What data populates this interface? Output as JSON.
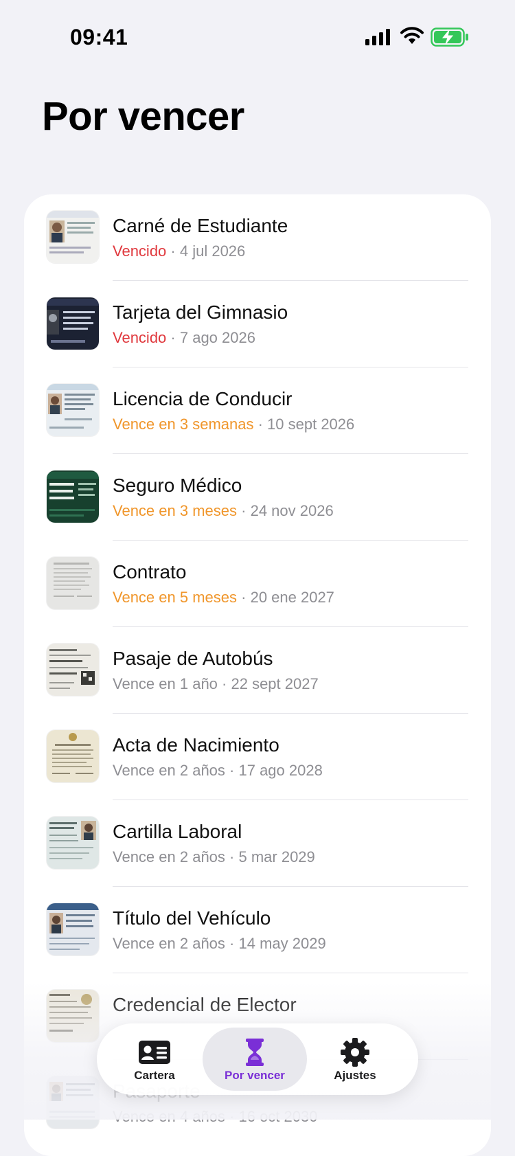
{
  "status_bar": {
    "time": "09:41"
  },
  "page": {
    "title": "Por vencer"
  },
  "documents": [
    {
      "title": "Carné de Estudiante",
      "status": "Vencido",
      "status_kind": "red",
      "date": "4 jul 2026",
      "thumb_icon": "student-id-thumbnail"
    },
    {
      "title": "Tarjeta del Gimnasio",
      "status": "Vencido",
      "status_kind": "red",
      "date": "7 ago 2026",
      "thumb_icon": "gym-card-thumbnail"
    },
    {
      "title": "Licencia de Conducir",
      "status": "Vence en 3 semanas",
      "status_kind": "orange",
      "date": "10 sept 2026",
      "thumb_icon": "drivers-license-thumbnail"
    },
    {
      "title": "Seguro Médico",
      "status": "Vence en 3 meses",
      "status_kind": "orange",
      "date": "24 nov 2026",
      "thumb_icon": "health-insurance-thumbnail"
    },
    {
      "title": "Contrato",
      "status": "Vence en 5 meses",
      "status_kind": "orange",
      "date": "20 ene 2027",
      "thumb_icon": "contract-thumbnail"
    },
    {
      "title": "Pasaje de Autobús",
      "status": "Vence en 1 año",
      "status_kind": "gray",
      "date": "22 sept 2027",
      "thumb_icon": "bus-ticket-thumbnail"
    },
    {
      "title": "Acta de Nacimiento",
      "status": "Vence en 2 años",
      "status_kind": "gray",
      "date": "17 ago 2028",
      "thumb_icon": "birth-certificate-thumbnail"
    },
    {
      "title": "Cartilla Laboral",
      "status": "Vence en 2 años",
      "status_kind": "gray",
      "date": "5 mar 2029",
      "thumb_icon": "work-booklet-thumbnail"
    },
    {
      "title": "Título del Vehículo",
      "status": "Vence en 2 años",
      "status_kind": "gray",
      "date": "14 may 2029",
      "thumb_icon": "vehicle-title-thumbnail"
    },
    {
      "title": "Credencial de Elector",
      "status": "",
      "status_kind": "gray",
      "date": "",
      "thumb_icon": "voter-id-thumbnail"
    },
    {
      "title": "Pasaporte",
      "status": "Vence en 4 años",
      "status_kind": "gray",
      "date": "16 oct 2030",
      "thumb_icon": "passport-thumbnail"
    }
  ],
  "separator": " · ",
  "tabbar": {
    "tabs": [
      {
        "label": "Cartera",
        "icon": "id-card-icon",
        "active": false
      },
      {
        "label": "Por vencer",
        "icon": "hourglass-icon",
        "active": true
      },
      {
        "label": "Ajustes",
        "icon": "gear-icon",
        "active": false
      }
    ]
  },
  "colors": {
    "expired": "#e0393e",
    "soon": "#f0962b",
    "later": "#8e8e93",
    "accent": "#7a2fd6"
  }
}
